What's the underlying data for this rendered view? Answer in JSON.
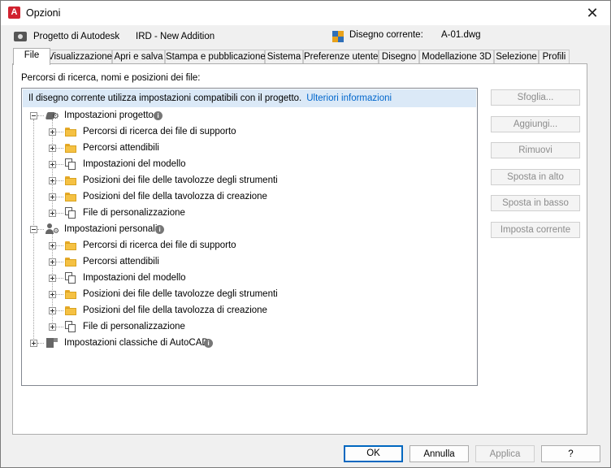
{
  "window": {
    "title": "Opzioni",
    "app_icon_letter": "A"
  },
  "infobar": {
    "project_label": "Progetto di Autodesk",
    "project_value": "IRD - New Addition",
    "drawing_label": "Disegno corrente:",
    "drawing_value": "A-01.dwg"
  },
  "tabs": [
    {
      "label": "File",
      "active": true
    },
    {
      "label": "Visualizzazione"
    },
    {
      "label": "Apri e salva"
    },
    {
      "label": "Stampa e pubblicazione"
    },
    {
      "label": "Sistema"
    },
    {
      "label": "Preferenze utente"
    },
    {
      "label": "Disegno"
    },
    {
      "label": "Modellazione 3D"
    },
    {
      "label": "Selezione"
    },
    {
      "label": "Profili"
    }
  ],
  "files_tab": {
    "section_label": "Percorsi di ricerca, nomi e posizioni dei file:",
    "banner_text": "Il disegno corrente utilizza impostazioni compatibili con il progetto.",
    "banner_link": "Ulteriori informazioni",
    "tree": {
      "project": {
        "label": "Impostazioni progetto",
        "children": [
          "Percorsi di ricerca dei file di supporto",
          "Percorsi attendibili",
          "Impostazioni del modello",
          "Posizioni dei file delle tavolozze degli strumenti",
          "Posizioni del file della tavolozza di creazione",
          "File di personalizzazione"
        ]
      },
      "personal": {
        "label": "Impostazioni personali",
        "children": [
          "Percorsi di ricerca dei file di supporto",
          "Percorsi attendibili",
          "Impostazioni del modello",
          "Posizioni dei file delle tavolozze degli strumenti",
          "Posizioni del file della tavolozza di creazione",
          "File di personalizzazione"
        ]
      },
      "classic": {
        "label": "Impostazioni classiche di AutoCAD"
      }
    },
    "side_buttons": [
      "Sfoglia...",
      "Aggiungi...",
      "Rimuovi",
      "Sposta in alto",
      "Sposta in basso",
      "Imposta corrente"
    ]
  },
  "footer": {
    "ok": "OK",
    "cancel": "Annulla",
    "apply": "Applica",
    "help": "?"
  },
  "colors": {
    "banner_bg": "#dbe9f7",
    "link": "#0066cc",
    "ok_border": "#0067c0",
    "app_icon": "#d1222f"
  }
}
